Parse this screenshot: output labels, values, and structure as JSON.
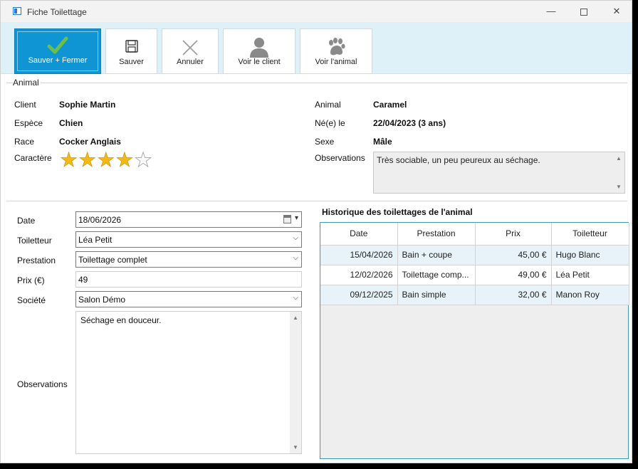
{
  "window": {
    "title": "Fiche Toilettage"
  },
  "toolbar": {
    "save_close": "Sauver + Fermer",
    "save": "Sauver",
    "cancel": "Annuler",
    "view_client": "Voir le client",
    "view_animal": "Voir l'animal"
  },
  "animal_section": {
    "legend": "Animal",
    "client_label": "Client",
    "client_value": "Sophie Martin",
    "species_label": "Espèce",
    "species_value": "Chien",
    "breed_label": "Race",
    "breed_value": "Cocker Anglais",
    "character_label": "Caractère",
    "character_rating": 4,
    "character_max": 5,
    "animal_label": "Animal",
    "animal_value": "Caramel",
    "born_label": "Né(e) le",
    "born_value": "22/04/2023 (3 ans)",
    "sex_label": "Sexe",
    "sex_value": "Mâle",
    "observations_label": "Observations",
    "observations_value": "Très sociable, un peu peureux au séchage."
  },
  "form": {
    "date_label": "Date",
    "date_value": "18/06/2026",
    "groomer_label": "Toiletteur",
    "groomer_value": "Léa Petit",
    "service_label": "Prestation",
    "service_value": "Toilettage complet",
    "price_label": "Prix (€)",
    "price_value": "49",
    "company_label": "Société",
    "company_value": "Salon Démo",
    "observations_label": "Observations",
    "observations_value": "Séchage en douceur."
  },
  "history": {
    "title": "Historique des toilettages de l'animal",
    "columns": [
      "Date",
      "Prestation",
      "Prix",
      "Toiletteur"
    ],
    "rows": [
      {
        "date": "15/04/2026",
        "service": "Bain + coupe",
        "price": "45,00 €",
        "groomer": "Hugo Blanc"
      },
      {
        "date": "12/02/2026",
        "service": "Toilettage  comp...",
        "price": "49,00 €",
        "groomer": "Léa Petit"
      },
      {
        "date": "09/12/2025",
        "service": "Bain simple",
        "price": "32,00 €",
        "groomer": "Manon Roy"
      }
    ]
  },
  "colors": {
    "primary_button": "#0f95d4",
    "toolbar_bg": "#dff1f8",
    "star_on": "#f3b916",
    "grid_border": "#3a9bb2",
    "row_alt": "#e8f3f9"
  }
}
